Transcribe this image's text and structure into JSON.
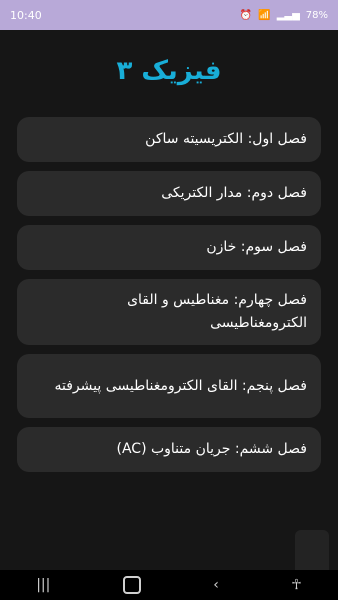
{
  "status": {
    "time": "10:40",
    "battery": "78%"
  },
  "app": {
    "title": "فیزیک ۳"
  },
  "chapters": [
    {
      "label": "فصل اول: الکتریسیته ساکن"
    },
    {
      "label": "فصل دوم: مدار الکتریکی"
    },
    {
      "label": "فصل سوم: خازن"
    },
    {
      "label": "فصل چهارم: مغناطیس و القای الکترومغناطیسی"
    },
    {
      "label": "فصل پنجم: القای الکترومغناطیسی پیشرفته"
    },
    {
      "label": "فصل ششم: جریان متناوب (AC)"
    }
  ],
  "icons": {
    "wifi": "wifi-icon",
    "signal": "signal-icon",
    "battery": "battery-icon",
    "back": "back-icon",
    "home": "home-icon",
    "recent": "recent-apps-icon"
  }
}
